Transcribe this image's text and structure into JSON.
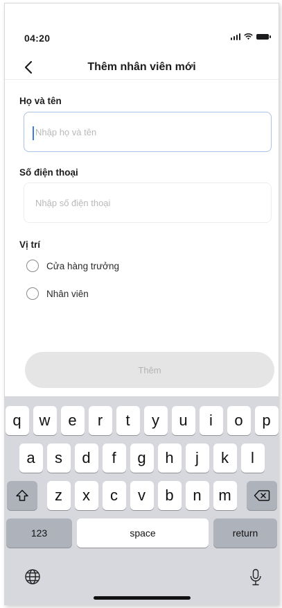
{
  "status_bar": {
    "time": "04:20",
    "icons": [
      "signal-icon",
      "wifi-icon",
      "battery-icon"
    ]
  },
  "nav": {
    "back_icon": "chevron-left-icon",
    "title": "Thêm nhân viên mới"
  },
  "form": {
    "name": {
      "label": "Họ và tên",
      "placeholder": "Nhập họ và tên",
      "value": "",
      "focused": true
    },
    "phone": {
      "label": "Số điện thoại",
      "placeholder": "Nhập số điện thoại",
      "value": ""
    },
    "position": {
      "label": "Vị trí",
      "options": [
        {
          "label": "Cửa hàng trưởng",
          "selected": false
        },
        {
          "label": "Nhân viên",
          "selected": false
        }
      ]
    },
    "submit_label": "Thêm"
  },
  "keyboard": {
    "row1": [
      "q",
      "w",
      "e",
      "r",
      "t",
      "y",
      "u",
      "i",
      "o",
      "p"
    ],
    "row2": [
      "a",
      "s",
      "d",
      "f",
      "g",
      "h",
      "j",
      "k",
      "l"
    ],
    "row3": [
      "z",
      "x",
      "c",
      "v",
      "b",
      "n",
      "m"
    ],
    "shift_icon": "shift-icon",
    "delete_icon": "backspace-icon",
    "numbers_label": "123",
    "space_label": "space",
    "return_label": "return",
    "globe_icon": "globe-icon",
    "mic_icon": "microphone-icon"
  },
  "colors": {
    "focus_border": "#a9c2e9",
    "caret": "#3f7ae0",
    "button_disabled_bg": "#e5e5e5",
    "keyboard_bg": "#d6d8de"
  }
}
